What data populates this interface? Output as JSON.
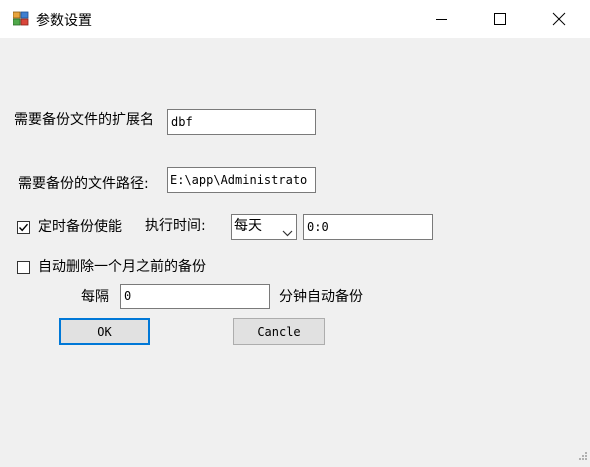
{
  "window": {
    "title": "参数设置",
    "icon": "app-settings-icon"
  },
  "form": {
    "ext_label": "需要备份文件的扩展名",
    "ext_value": "dbf",
    "path_label": "需要备份的文件路径:",
    "path_value": "E:\\app\\Administrato",
    "timer_enable_label": "定时备份使能",
    "timer_enable_checked": true,
    "exec_time_label": "执行时间:",
    "freq_selected": "每天",
    "time_value": "0:0",
    "auto_delete_label": "自动删除一个月之前的备份",
    "auto_delete_checked": false,
    "interval_label_prefix": "每隔",
    "interval_value": "0",
    "interval_label_suffix": "分钟自动备份"
  },
  "buttons": {
    "ok": "OK",
    "cancel": "Cancle"
  },
  "colors": {
    "title_bg": "#ffffff",
    "window_bg": "#f0f0f0",
    "focus_border": "#0078d7",
    "button_bg": "#e1e1e1"
  }
}
